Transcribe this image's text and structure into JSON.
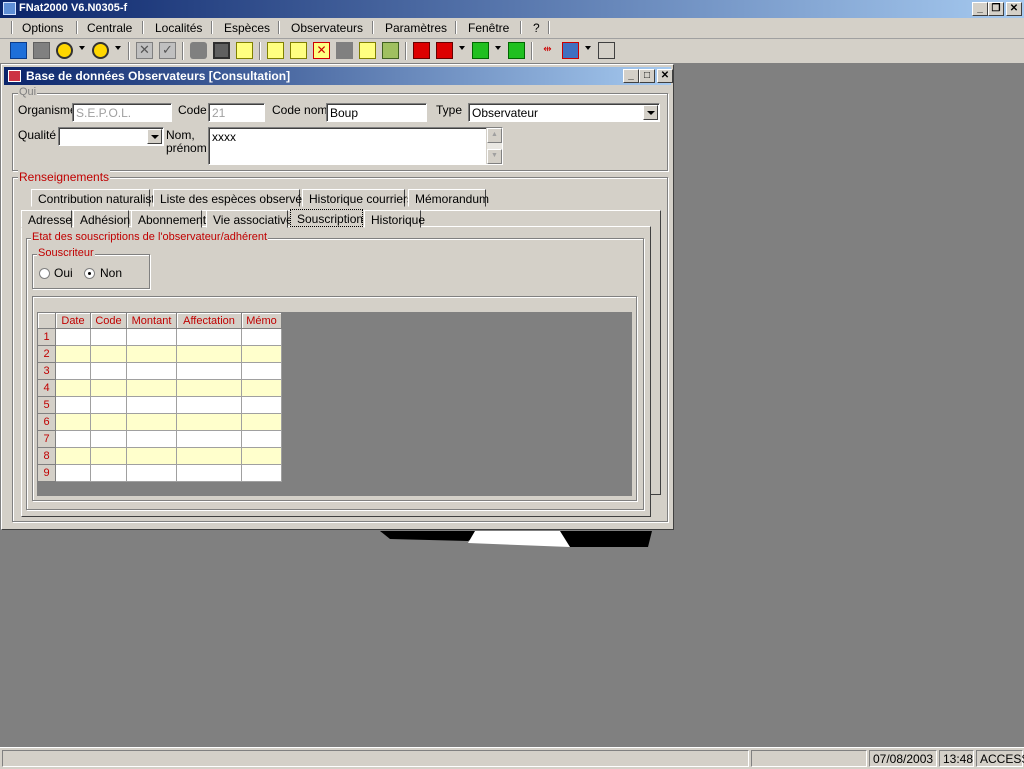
{
  "app": {
    "title": "FNat2000 V6.N0305-f"
  },
  "menu": [
    "Options",
    "Centrale",
    "Localités",
    "Espèces",
    "Observateurs",
    "Paramètres",
    "Fenêtre",
    "?"
  ],
  "window": {
    "title": "Base de données Observateurs [Consultation]",
    "qui_legend": "Qui",
    "labels": {
      "organisme": "Organisme",
      "code": "Code",
      "code_nom": "Code nom",
      "type": "Type",
      "qualite": "Qualité",
      "nom_line1": "Nom,",
      "nom_line2": "prénom"
    },
    "values": {
      "organisme": "S.E.P.O.L.",
      "code": "21",
      "code_nom": "Boup",
      "type": "Observateur",
      "qualite": "",
      "nom": "xxxx"
    },
    "renseignements_legend": "Renseignements",
    "tabs_row1": [
      "Contribution naturaliste",
      "Liste des espèces observées",
      "Historique courriers",
      "Mémorandum"
    ],
    "tabs_row2": [
      "Adresse",
      "Adhésion",
      "Abonnement",
      "Vie associative",
      "Souscription",
      "Historique"
    ],
    "active_tab": "Souscription",
    "etat_legend": "Etat des souscriptions de l'observateur/adhérent",
    "souscripteur_legend": "Souscriteur",
    "radio_oui": "Oui",
    "radio_non": "Non",
    "radio_selected": "Non",
    "grid": {
      "columns": [
        "Date",
        "Code",
        "Montant",
        "Affectation",
        "Mémo"
      ],
      "rows": [
        "1",
        "2",
        "3",
        "4",
        "5",
        "6",
        "7",
        "8",
        "9"
      ]
    }
  },
  "status": {
    "date": "07/08/2003",
    "time": "13:48",
    "mode": "ACCESS"
  },
  "colors": {
    "title_gradient_start": "#0a246a",
    "title_gradient_end": "#a6caf0",
    "label_red": "#c00000",
    "row_alt": "#ffffcc",
    "workspace": "#808080"
  }
}
